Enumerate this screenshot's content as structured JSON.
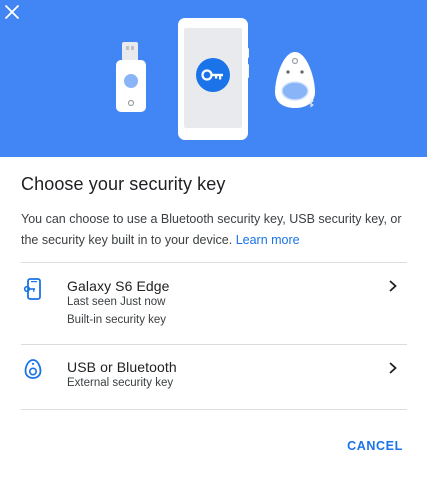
{
  "header": {
    "illustration": [
      "usb-key",
      "phone-with-key",
      "bluetooth-key"
    ],
    "close_icon": "close-icon",
    "banner_color": "#4285f4"
  },
  "dialog": {
    "title": "Choose your security key",
    "description": "You can choose to use a Bluetooth security key, USB security key, or the security key built in to your device.",
    "learn_more": "Learn more"
  },
  "options": [
    {
      "icon": "phone-key-icon",
      "title": "Galaxy S6 Edge",
      "line1": "Last seen Just now",
      "line2": "Built-in security key"
    },
    {
      "icon": "key-fob-icon",
      "title": "USB or Bluetooth",
      "line1": "External security key"
    }
  ],
  "footer": {
    "cancel_label": "CANCEL"
  },
  "colors": {
    "accent": "#1a73e8",
    "divider": "#dadce0"
  }
}
